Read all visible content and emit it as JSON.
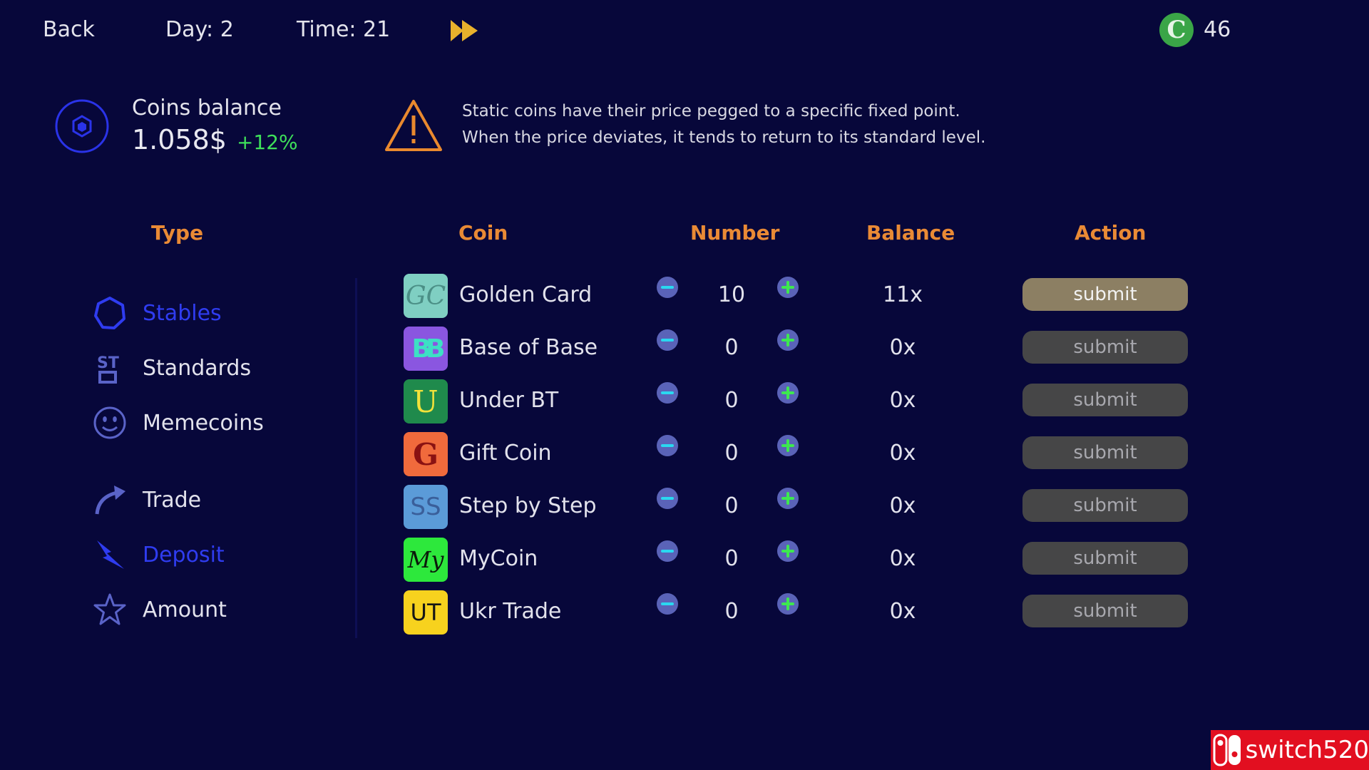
{
  "topbar": {
    "back_label": "Back",
    "day": "Day: 2",
    "time": "Time: 21",
    "coin_symbol": "C",
    "coin_count": "46"
  },
  "balance": {
    "label": "Coins balance",
    "value": "1.058$",
    "change": "+12%"
  },
  "warning": {
    "line1": "Static coins have their price pegged to a specific fixed point.",
    "line2": "When the price deviates, it tends to return to its standard level."
  },
  "headers": {
    "type": "Type",
    "coin": "Coin",
    "number": "Number",
    "balance": "Balance",
    "action": "Action"
  },
  "sidebar": {
    "items": [
      {
        "label": "Stables",
        "icon": "hexagon-icon",
        "active": true
      },
      {
        "label": "Standards",
        "icon": "st-icon",
        "active": false
      },
      {
        "label": "Memecoins",
        "icon": "smiley-icon",
        "active": false
      },
      {
        "label": "Trade",
        "icon": "arrow-up-right-icon",
        "active": false
      },
      {
        "label": "Deposit",
        "icon": "lightning-icon",
        "active": true
      },
      {
        "label": "Amount",
        "icon": "star-icon",
        "active": false
      }
    ]
  },
  "rows": [
    {
      "name": "Golden Card",
      "logo_text": "GC",
      "logo_bg": "#7fcfc2",
      "logo_fg": "#4b8f86",
      "number": "10",
      "balance": "11x",
      "action": "submit",
      "primary": true
    },
    {
      "name": "Base of Base",
      "logo_text": "BB",
      "logo_bg": "#8a56e0",
      "logo_fg": "#3de0c4",
      "number": "0",
      "balance": "0x",
      "action": "submit",
      "primary": false
    },
    {
      "name": "Under BT",
      "logo_text": "U",
      "logo_bg": "#1f8a4c",
      "logo_fg": "#f2e23a",
      "number": "0",
      "balance": "0x",
      "action": "submit",
      "primary": false
    },
    {
      "name": "Gift Coin",
      "logo_text": "G",
      "logo_bg": "#f06a3c",
      "logo_fg": "#8a1212",
      "number": "0",
      "balance": "0x",
      "action": "submit",
      "primary": false
    },
    {
      "name": "Step by Step",
      "logo_text": "SS",
      "logo_bg": "#5b9bd8",
      "logo_fg": "#3a5f9a",
      "number": "0",
      "balance": "0x",
      "action": "submit",
      "primary": false
    },
    {
      "name": "MyCoin",
      "logo_text": "My",
      "logo_bg": "#2de83c",
      "logo_fg": "#0b1a0b",
      "number": "0",
      "balance": "0x",
      "action": "submit",
      "primary": false
    },
    {
      "name": "Ukr Trade",
      "logo_text": "UT",
      "logo_bg": "#f7d21e",
      "logo_fg": "#161616",
      "number": "0",
      "balance": "0x",
      "action": "submit",
      "primary": false
    }
  ],
  "watermark": {
    "text": "switch520"
  }
}
